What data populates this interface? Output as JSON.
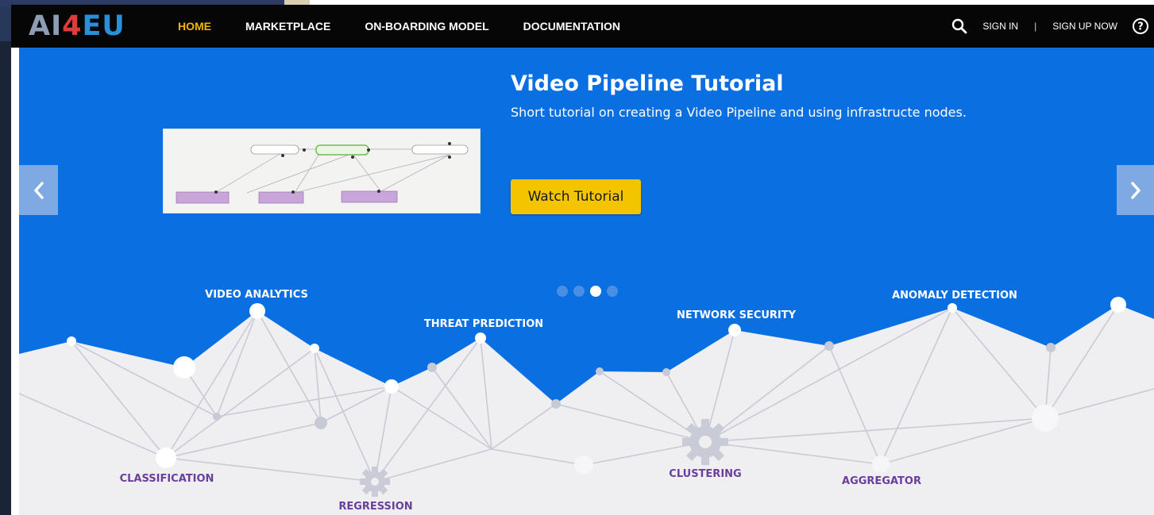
{
  "nav": {
    "logo": {
      "part1": "AI",
      "part2": "4",
      "part3": "EU"
    },
    "links": [
      "HOME",
      "MARKETPLACE",
      "ON-BOARDING MODEL",
      "DOCUMENTATION"
    ],
    "active": "HOME",
    "sign_in": "SIGN IN",
    "separator": "|",
    "sign_up": "SIGN UP NOW"
  },
  "hero": {
    "slide": {
      "title": "Video Pipeline Tutorial",
      "subtitle": "Short tutorial on creating a Video Pipeline and using infrastructe nodes.",
      "button_label": "Watch Tutorial"
    },
    "carousel": {
      "total": 4,
      "active_index": 2
    },
    "categories_top": [
      "VIDEO ANALYTICS",
      "THREAT PREDICTION",
      "NETWORK SECURITY",
      "ANOMALY DETECTION"
    ],
    "categories_bottom": [
      "CLASSIFICATION",
      "REGRESSION",
      "CLUSTERING",
      "AGGREGATOR"
    ]
  },
  "colors": {
    "navbar_bg": "#060606",
    "nav_active": "#f2b705",
    "hero_bg": "#0a6fe0",
    "button_bg": "#f5c400",
    "category_bottom": "#6a3f9c",
    "mountain": "#efeff2"
  },
  "icons": {
    "search": "search-icon",
    "help": "help-icon",
    "prev": "chevron-left-icon",
    "next": "chevron-right-icon",
    "gear": "gear-icon"
  }
}
